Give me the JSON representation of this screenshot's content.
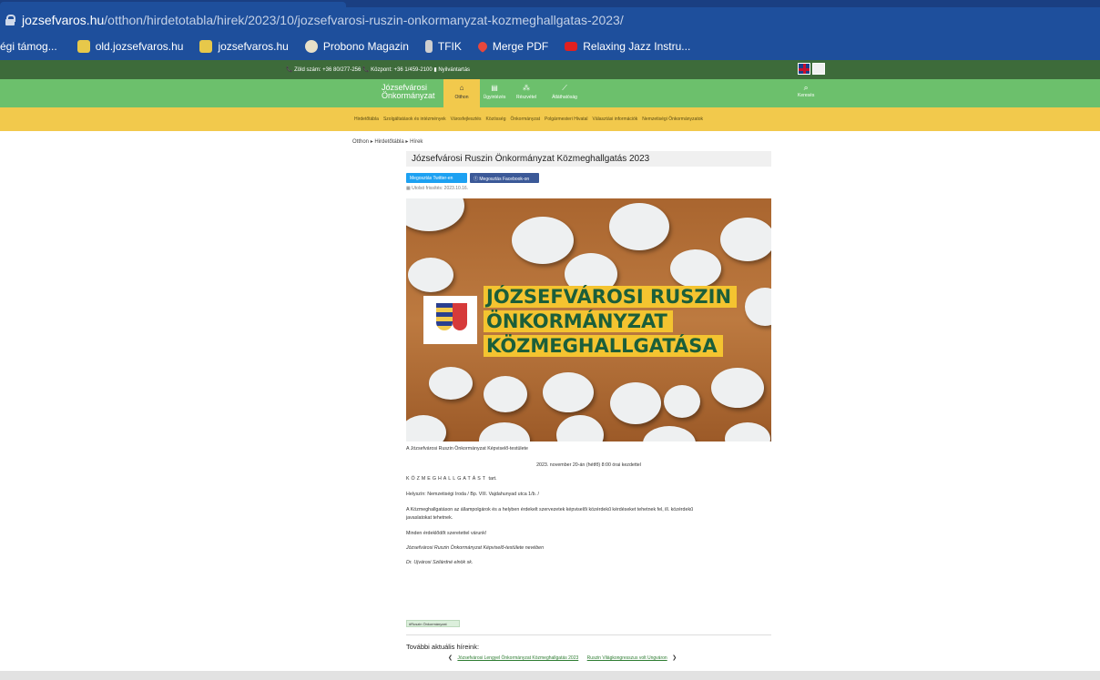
{
  "browser": {
    "host": "jozsefvaros.hu",
    "path": "/otthon/hirdetotabla/hirek/2023/10/jozsefvarosi-ruszin-onkormanyzat-kozmeghallgatas-2023/"
  },
  "bookmarks": [
    {
      "label": "égi támog...",
      "icon": "bookmark-icon",
      "color": "#1e4f9c"
    },
    {
      "label": "old.jozsefvaros.hu",
      "icon": "crest-icon",
      "color": "#e7c84a"
    },
    {
      "label": "jozsefvaros.hu",
      "icon": "crest-icon",
      "color": "#e7c84a"
    },
    {
      "label": "Probono Magazin",
      "icon": "circle-icon",
      "color": "#e8e0c8"
    },
    {
      "label": "TFIK",
      "icon": "lantern-icon",
      "color": "#cfcfcf"
    },
    {
      "label": "Merge PDF",
      "icon": "heart-icon",
      "color": "#e8473c"
    },
    {
      "label": "Relaxing Jazz Instru...",
      "icon": "youtube-icon",
      "color": "#e02020"
    }
  ],
  "infobar": {
    "text": "📞 Zöld szám: +36 80/277-256  📞 Központ: +36 1/459-2100  ▮ Nyilvántartás"
  },
  "nav": {
    "logo_line1": "Józsefvárosi",
    "logo_line2": "Önkormányzat",
    "items": [
      {
        "label": "Otthon",
        "icon": "home-icon",
        "glyph": "⌂"
      },
      {
        "label": "Ügyintézés",
        "icon": "document-icon",
        "glyph": "▤"
      },
      {
        "label": "Részvétel",
        "icon": "people-icon",
        "glyph": "⁂"
      },
      {
        "label": "Átláthatóság",
        "icon": "chart-icon",
        "glyph": "⟋"
      }
    ],
    "search_label": "Keresés",
    "search_glyph": "⌕"
  },
  "subnav": [
    "Hirdetőtábla",
    "Szolgáltatások és intézmények",
    "Városfejlesztés",
    "Közösség",
    "Önkormányzat",
    "Polgármesteri Hivatal",
    "Választási információk",
    "Nemzetiségi Önkormányzatok"
  ],
  "breadcrumb": {
    "home": "Otthon",
    "sep1": "▸",
    "section": "Hirdetőtábla",
    "sep2": "▸",
    "current": "Hírek"
  },
  "article": {
    "title": "Józsefvárosi Ruszin Önkormányzat Közmeghallgatás 2023",
    "share_twitter": "Megosztás Twitter-en",
    "share_facebook": "ⓕ Megosztás Facebook-on",
    "updated": "▦ Utolsó frissítés: 2023.10.16.",
    "hero_line1": "JÓZSEFVÁROSI RUSZIN",
    "hero_line2": "ÖNKORMÁNYZAT",
    "hero_line3": "KÖZMEGHALLGATÁSA",
    "p1": "A Józsefvárosi Ruszin Önkormányzat Képviselő-testülete",
    "p2": "2023. november 20-án (hétfő) 8:00 órai kezdettel",
    "p3a": "KÖZMEGHALLGATÁST",
    "p3b": "tart.",
    "p4": "Helyszín: Nemzetiségi Iroda / Bp. VIII. Vajdahunyad utca 1/b. /",
    "p5a": "A Közmeghallgatáson az állampolgárok és a helyben érdekelt szervezetek képviselői közérdekű kérdéseket tehetnek fel, ill. közérdekű",
    "p5b": "javaslatokat tehetnek.",
    "p6": "Minden érdeklődőt szeretettel várunk!",
    "p7": "Józsefvárosi Ruszin Önkormányzat Képviselő-testülete nevében",
    "p8": "Dr. Ujvárosi Szilárdné elnök sk.",
    "tag": "#Ruszin Önkormányzat"
  },
  "more": {
    "heading": "További aktuális híreink:",
    "prev_arrow": "❮",
    "prev": "Józsefvárosi Lengyel Önkormányzat Közmeghallgatás 2023",
    "next": "Ruszin Világkongresszus volt Ungváron",
    "next_arrow": "❯"
  }
}
